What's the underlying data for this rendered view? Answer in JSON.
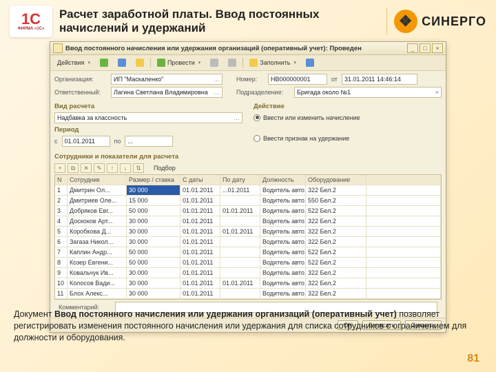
{
  "header": {
    "logo1c_top": "1С",
    "logo1c_bottom": "ФИРМА «1С»",
    "title": "Расчет заработной платы. Ввод постоянных начислений и удержаний",
    "sinergo": "СИНЕРГО"
  },
  "window": {
    "title": "Ввод постоянного начисления или удержания организаций (оперативный учет): Проведен",
    "toolbar": {
      "actions": "Действия",
      "conduct": "Провести",
      "fill": "Заполнить"
    },
    "fields": {
      "org_label": "Организация:",
      "org_value": "ИП \"Маскаленко\"",
      "num_label": "Номер:",
      "num_value": "НВ000000001",
      "date_label": "от",
      "date_value": "31.01.2011 14:46:14",
      "resp_label": "Ответственный:",
      "resp_value": "Лагина Светлана Владимировна",
      "subdiv_label": "Подразделение:",
      "subdiv_value": "Бригада около №1"
    },
    "group_calc": {
      "title": "Вид расчета",
      "value": "Надбавка за классность"
    },
    "group_period": {
      "title": "Период",
      "from_label": "с",
      "from_value": "01.01.2011",
      "to_label": "по",
      "to_value": "..."
    },
    "group_action": {
      "title": "Действие",
      "r1": "Ввести или изменить начисление",
      "r2": "Ввести признак на удержание"
    },
    "employees": {
      "title": "Сотрудники и показатели для расчета",
      "fill_btn": "Подбор",
      "cols": [
        "N",
        "Сотрудник",
        "Размер / ставка",
        "С даты",
        "По дату",
        "Должность",
        "Оборудование"
      ],
      "rows": [
        [
          "1",
          "Дмитрин Ол...",
          "30 000",
          "01.01.2011",
          "...01.2011",
          "Водитель авто...",
          "322 Бел.2"
        ],
        [
          "2",
          "Дмитриев Оле...",
          "15 000",
          "01.01.2011",
          "",
          "Водитель авто...",
          "550 Бел.2"
        ],
        [
          "3",
          "Добряков Евг...",
          "50 000",
          "01.01.2011",
          "01.01.2011",
          "Водитель авто...",
          "522 Бел.2"
        ],
        [
          "4",
          "Доскоков Арт...",
          "30 000",
          "01.01.2011",
          "",
          "Водитель авто...",
          "322 Бел.2"
        ],
        [
          "5",
          "Коробкова Д...",
          "30 000",
          "01.01.2011",
          "01.01.2011",
          "Водитель авто...",
          "322 Бел.2"
        ],
        [
          "6",
          "Загаза Никол...",
          "30 000",
          "01.01.2011",
          "",
          "Водитель авто...",
          "322 Бел.2"
        ],
        [
          "7",
          "Каплин Андр...",
          "50 000",
          "01.01.2011",
          "",
          "Водитель авто...",
          "522 Бел.2"
        ],
        [
          "8",
          "Козер Евгени...",
          "50 000",
          "01.01.2011",
          "",
          "Водитель авто...",
          "522 Бел.2"
        ],
        [
          "9",
          "Ковальчук Ив...",
          "30 000",
          "01.01.2011",
          "",
          "Водитель авто...",
          "322 Бел.2"
        ],
        [
          "10",
          "Колосов Вади...",
          "30 000",
          "01.01.2011",
          "01.01.2011",
          "Водитель авто...",
          "322 Бел.2"
        ],
        [
          "11",
          "Блох Алекс...",
          "30 000",
          "01.01.2011",
          "",
          "Водитель авто...",
          "322 Бел.2"
        ]
      ]
    },
    "comment_label": "Комментарий:",
    "buttons": {
      "ok": "ОК",
      "write": "Записать",
      "close": "Закрыть"
    }
  },
  "caption_html": "Документ <b>Ввод постоянного начисления или удержания организаций (оперативный учет)</b> позволяет регистрировать изменения постоянного начисления или удержания для списка сотрудников с ограничением для должности и оборудования.",
  "page": "81"
}
